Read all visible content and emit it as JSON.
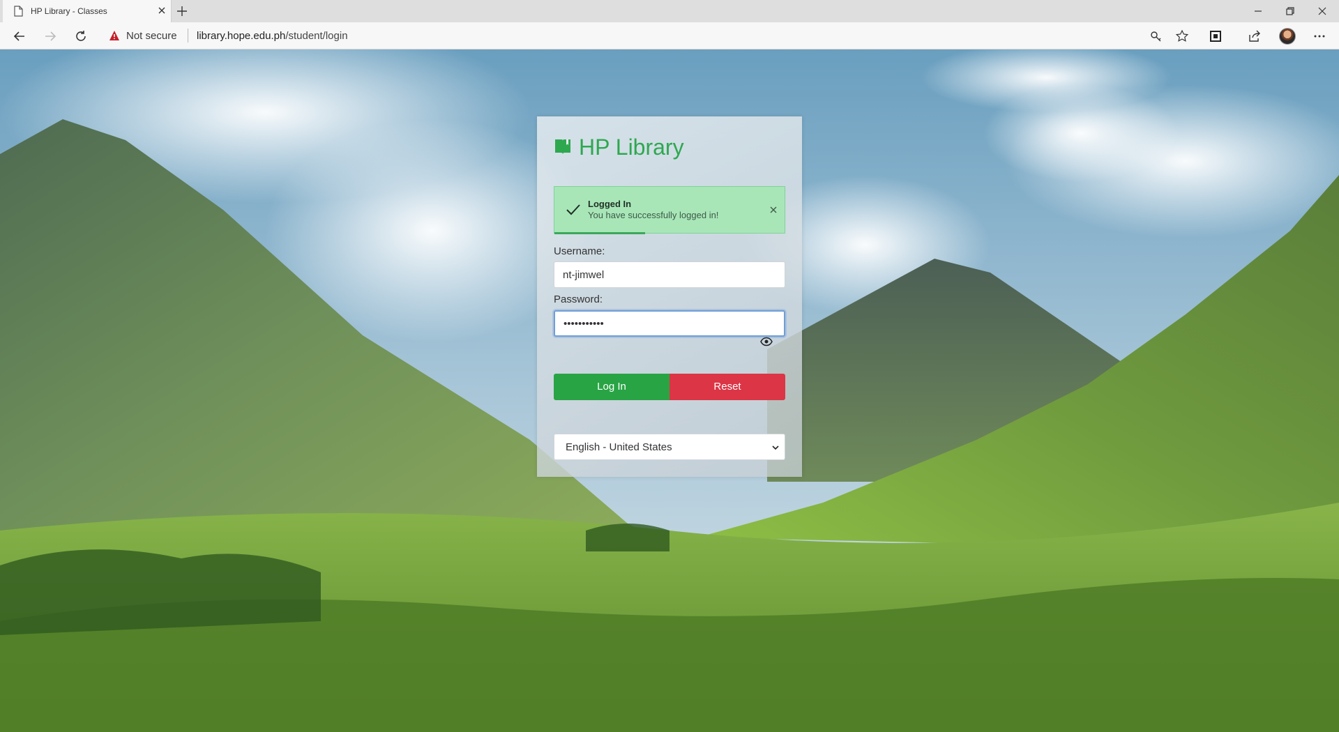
{
  "browser": {
    "tab_title": "HP Library - Classes",
    "security_label": "Not secure",
    "url_host": "library.hope.edu.ph",
    "url_path": "/student/login"
  },
  "login": {
    "brand": "HP Library",
    "toast": {
      "title": "Logged In",
      "message": "You have successfully logged in!"
    },
    "username_label": "Username:",
    "username_value": "nt-jimwel",
    "password_label": "Password:",
    "password_value": "•••••••••••",
    "login_button": "Log In",
    "reset_button": "Reset",
    "language_selected": "English - United States"
  },
  "colors": {
    "brand_green": "#2ea84f",
    "login_button": "#28a445",
    "reset_button": "#dc3545",
    "toast_background": "#a8e6b8"
  }
}
